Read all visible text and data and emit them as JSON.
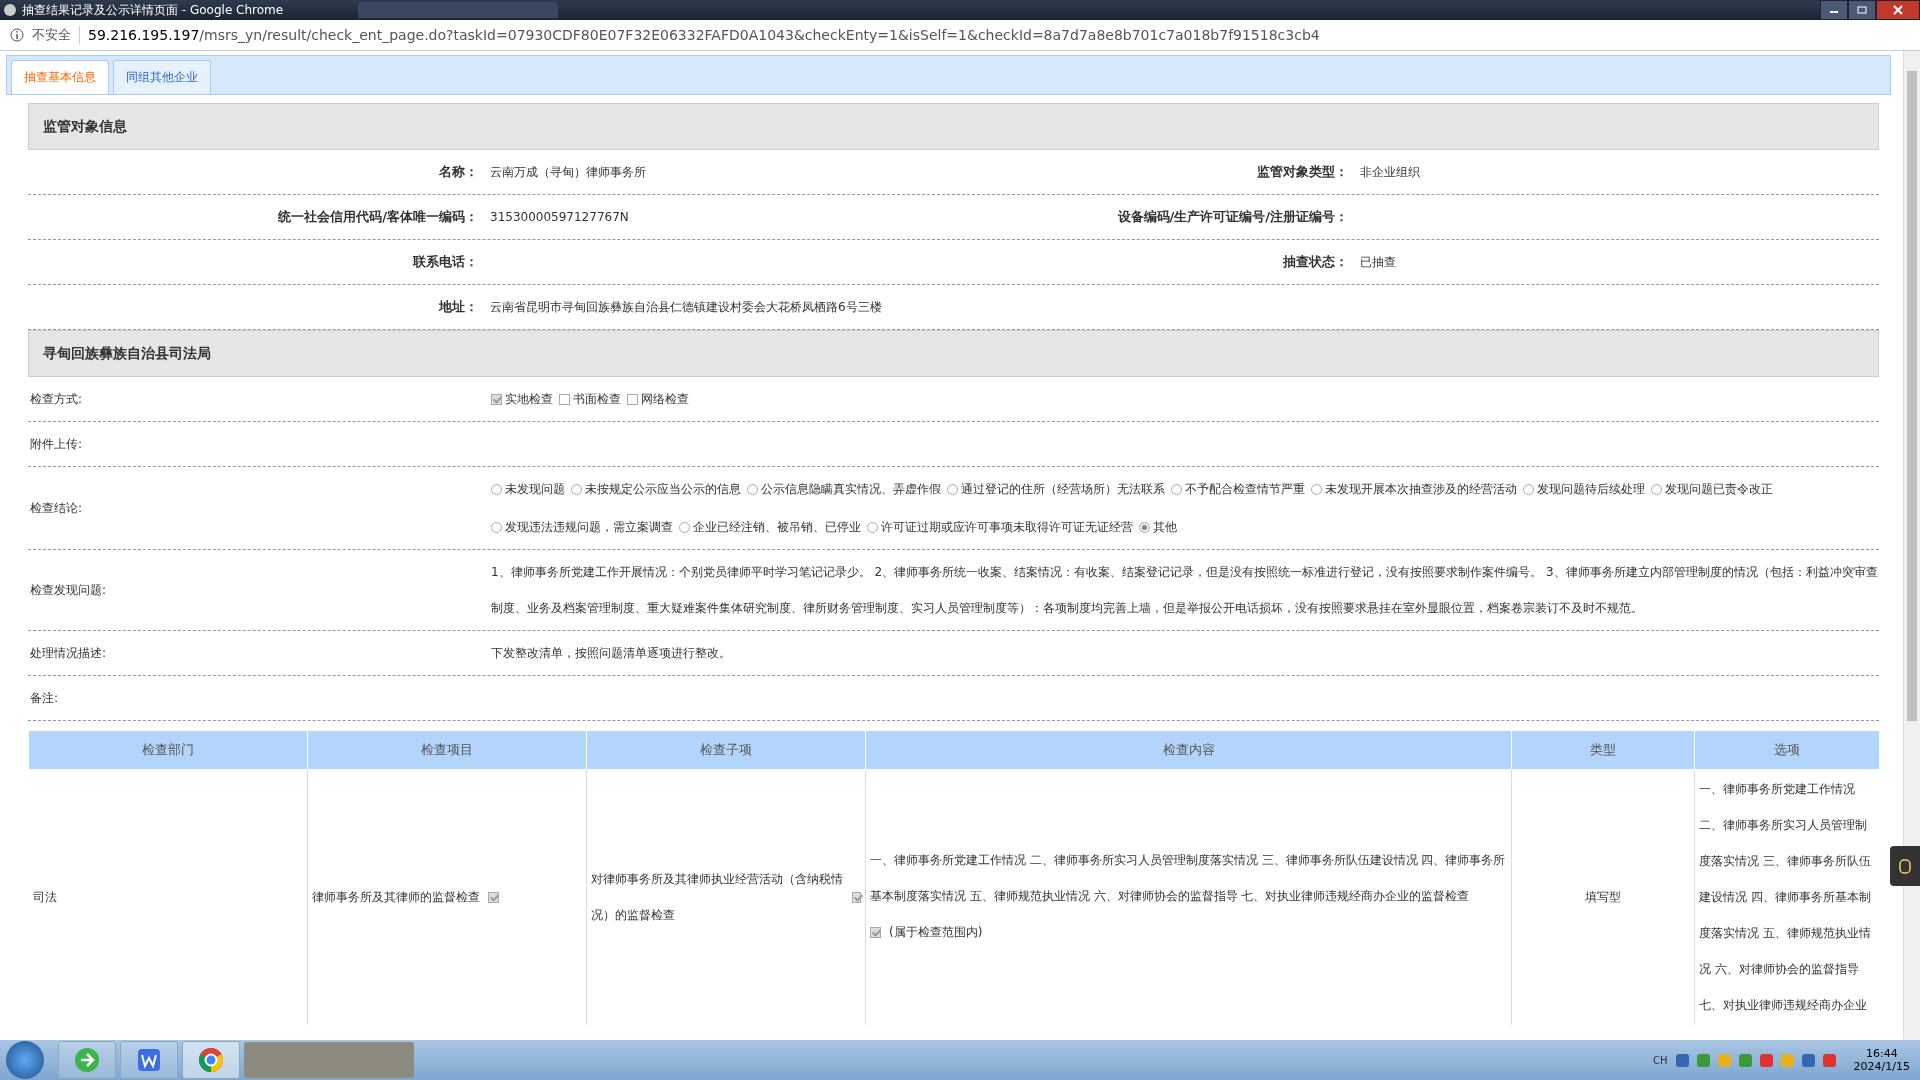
{
  "window": {
    "title": "抽查结果记录及公示详情页面 - Google Chrome"
  },
  "address_bar": {
    "security": "不安全",
    "url_host": "59.216.195.197",
    "url_path": "/msrs_yn/result/check_ent_page.do?taskId=07930CDF80E07F32E06332FAFD0A1043&checkEnty=1&isSelf=1&checkId=8a7d7a8e8b701c7a018b7f91518c3cb4"
  },
  "tabs": [
    {
      "label": "抽查基本信息",
      "selected": true
    },
    {
      "label": "同组其他企业",
      "selected": false
    }
  ],
  "subject_section": {
    "title": "监管对象信息",
    "rows": [
      {
        "label_1": "名称：",
        "value_1": "云南万成（寻甸）律师事务所",
        "label_2": "监管对象类型：",
        "value_2": "非企业组织"
      },
      {
        "label_1": "统一社会信用代码/客体唯一编码：",
        "value_1": "31530000597127767N",
        "label_2": "设备编码/生产许可证编号/注册证编号：",
        "value_2": ""
      },
      {
        "label_1": "联系电话：",
        "value_1": "",
        "label_2": "抽查状态：",
        "value_2": "已抽查"
      },
      {
        "label_1": "地址：",
        "value_1": "云南省昆明市寻甸回族彝族自治县仁德镇建设村委会大花桥凤栖路6号三楼"
      }
    ]
  },
  "inspection_section": {
    "title": "寻甸回族彝族自治县司法局",
    "method": {
      "label": "检查方式:",
      "options": [
        {
          "label": "实地检查",
          "checked": true
        },
        {
          "label": "书面检查",
          "checked": false
        },
        {
          "label": "网络检查",
          "checked": false
        }
      ]
    },
    "attachment": {
      "label": "附件上传:"
    },
    "conclusion": {
      "label": "检查结论:",
      "options": [
        {
          "label": "未发现问题",
          "selected": false
        },
        {
          "label": "未按规定公示应当公示的信息",
          "selected": false
        },
        {
          "label": "公示信息隐瞒真实情况、弄虚作假",
          "selected": false
        },
        {
          "label": "通过登记的住所（经营场所）无法联系",
          "selected": false
        },
        {
          "label": "不予配合检查情节严重",
          "selected": false
        },
        {
          "label": "未发现开展本次抽查涉及的经营活动",
          "selected": false
        },
        {
          "label": "发现问题待后续处理",
          "selected": false
        },
        {
          "label": "发现问题已责令改正",
          "selected": false
        },
        {
          "label": "发现违法违规问题，需立案调查",
          "selected": false
        },
        {
          "label": "企业已经注销、被吊销、已停业",
          "selected": false
        },
        {
          "label": "许可证过期或应许可事项未取得许可证无证经营",
          "selected": false
        },
        {
          "label": "其他",
          "selected": true
        }
      ]
    },
    "findings": {
      "label": "检查发现问题:",
      "text": "1、律师事务所党建工作开展情况：个别党员律师平时学习笔记记录少。 2、律师事务所统一收案、结案情况：有收案、结案登记记录，但是没有按照统一标准进行登记，没有按照要求制作案件编号。 3、律师事务所建立内部管理制度的情况（包括：利益冲突审查制度、业务及档案管理制度、重大疑难案件集体研究制度、律所财务管理制度、实习人员管理制度等）：各项制度均完善上墙，但是举报公开电话损坏，没有按照要求悬挂在室外显眼位置，档案卷宗装订不及时不规范。"
    },
    "handling": {
      "label": "处理情况描述:",
      "text": "下发整改清单，按照问题清单逐项进行整改。"
    },
    "remarks": {
      "label": "备注:"
    }
  },
  "table": {
    "columns": [
      "检查部门",
      "检查项目",
      "检查子项",
      "检查内容",
      "类型",
      "选项"
    ],
    "rows": [
      {
        "department": "司法",
        "item": "律师事务所及其律师的监督检查",
        "item_checked": true,
        "subitem": "对律师事务所及其律师执业经营活动（含纳税情况）的监督检查",
        "subitem_checked": true,
        "content": "一、律师事务所党建工作情况 二、律师事务所实习人员管理制度落实情况 三、律师事务所队伍建设情况 四、律师事务所基本制度落实情况 五、律师规范执业情况 六、对律师协会的监督指导 七、对执业律师违规经商办企业的监督检查",
        "content_checked": true,
        "content_note": "(属于检查范围内)",
        "type": "填写型",
        "options": [
          "一、律师事务所党建工作情况",
          "二、律师事务所实习人员管理制度落实情况 三、律师事务所队伍建设情况 四、律师事务所基本制度落实情况 五、律师规范执业情况 六、对律师协会的监督指导",
          "七、对执业律师违规经商办企业"
        ]
      }
    ]
  },
  "taskbar": {
    "language": "CH",
    "time": "16:44",
    "date": "2024/1/15"
  }
}
